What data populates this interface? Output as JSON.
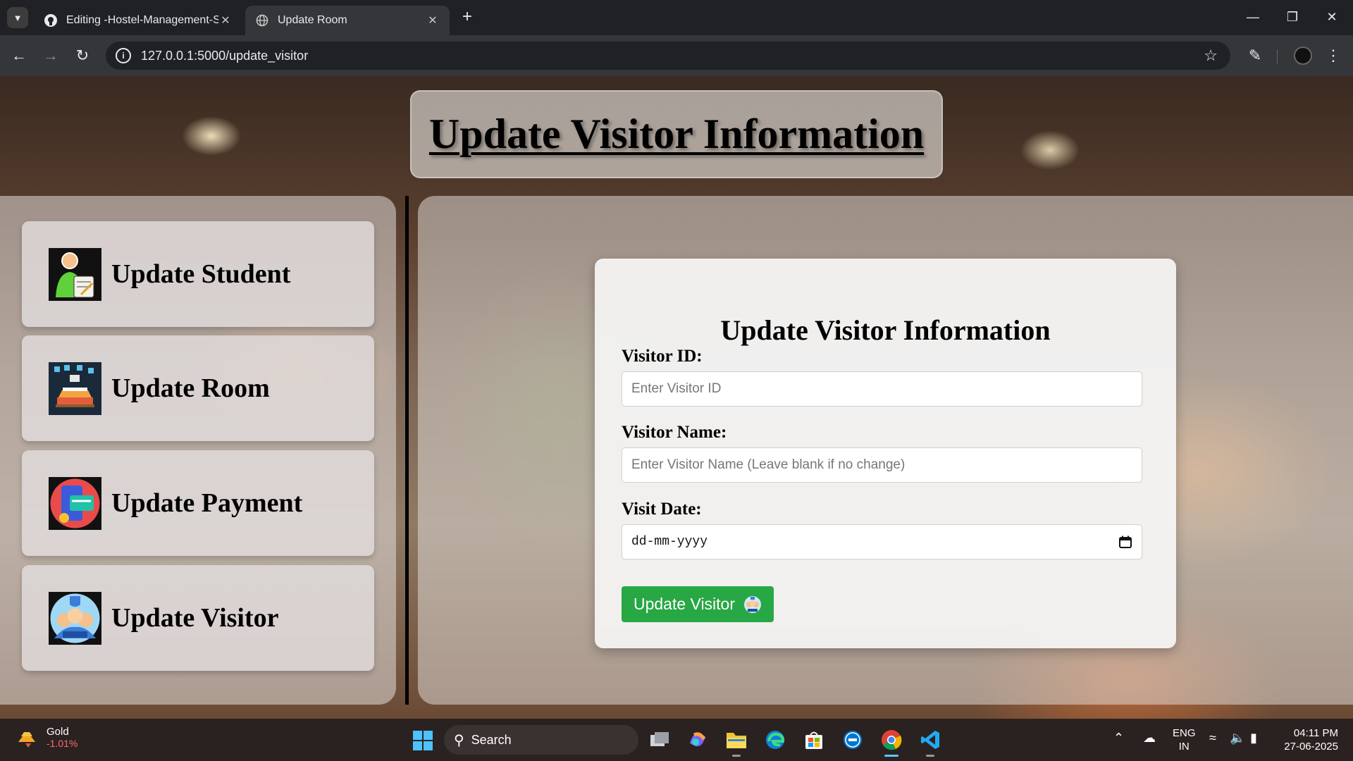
{
  "browser": {
    "tabs": [
      {
        "title": "Editing -Hostel-Management-S",
        "active": false,
        "icon": "github-icon"
      },
      {
        "title": "Update Room",
        "active": true,
        "icon": "globe-icon"
      }
    ],
    "url": "127.0.0.1:5000/update_visitor"
  },
  "page": {
    "title": "Update Visitor Information",
    "sidebar": [
      {
        "label": "Update Student",
        "icon": "student-icon"
      },
      {
        "label": "Update Room",
        "icon": "room-icon"
      },
      {
        "label": "Update Payment",
        "icon": "payment-icon"
      },
      {
        "label": "Update Visitor",
        "icon": "visitor-icon"
      }
    ],
    "form": {
      "heading": "Update Visitor Information",
      "visitor_id_label": "Visitor ID:",
      "visitor_id_placeholder": "Enter Visitor ID",
      "visitor_name_label": "Visitor Name:",
      "visitor_name_placeholder": "Enter Visitor Name (Leave blank if no change)",
      "visit_date_label": "Visit Date:",
      "visit_date_placeholder": "dd-mm-yyyy",
      "submit_label": "Update Visitor"
    }
  },
  "taskbar": {
    "widget_name": "Gold",
    "widget_change": "-1.01%",
    "search_label": "Search",
    "lang_line1": "ENG",
    "lang_line2": "IN",
    "time": "04:11 PM",
    "date": "27-06-2025"
  },
  "colors": {
    "submit_button": "#28a745",
    "browser_chrome": "#35363a",
    "tabbar": "#202124"
  }
}
